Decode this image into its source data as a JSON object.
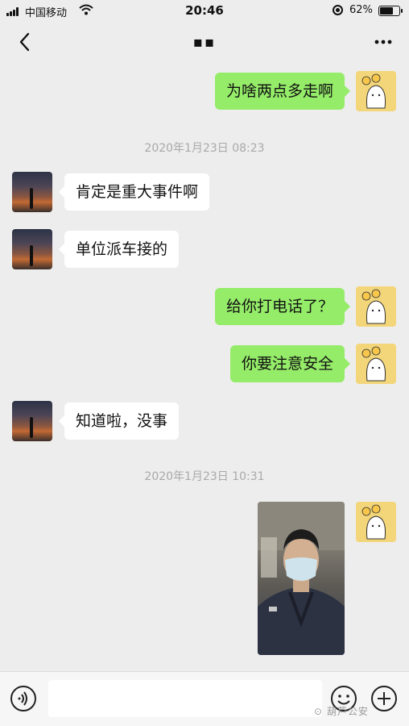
{
  "status_bar": {
    "carrier": "中国移动",
    "time": "20:46",
    "battery": "62%",
    "battery_level": 0.62
  },
  "header": {
    "title": "▪▪",
    "back_icon": "chevron-left-icon",
    "more_icon": "more-dots-icon"
  },
  "messages": [
    {
      "side": "right",
      "text": "为啥两点多走啊"
    },
    {
      "type": "time",
      "text": "2020年1月23日 08:23"
    },
    {
      "side": "left",
      "text": "肯定是重大事件啊"
    },
    {
      "side": "left",
      "text": "单位派车接的"
    },
    {
      "side": "right",
      "text": "给你打电话了？"
    },
    {
      "side": "right",
      "text": "你要注意安全"
    },
    {
      "side": "left",
      "text": "知道啦，没事"
    },
    {
      "type": "time",
      "text": "2020年1月23日 10:31"
    },
    {
      "side": "right",
      "type": "image",
      "description_icon": "photo-message"
    }
  ],
  "input_bar": {
    "placeholder": "",
    "voice_icon": "voice-icon",
    "emoji_icon": "emoji-icon",
    "plus_icon": "plus-icon",
    "watermark": "⊙ 葫芦公安"
  },
  "colors": {
    "background": "#ededed",
    "sent_bubble": "#95ec69",
    "received_bubble": "#ffffff",
    "timestamp_text": "#a9a9a9"
  }
}
